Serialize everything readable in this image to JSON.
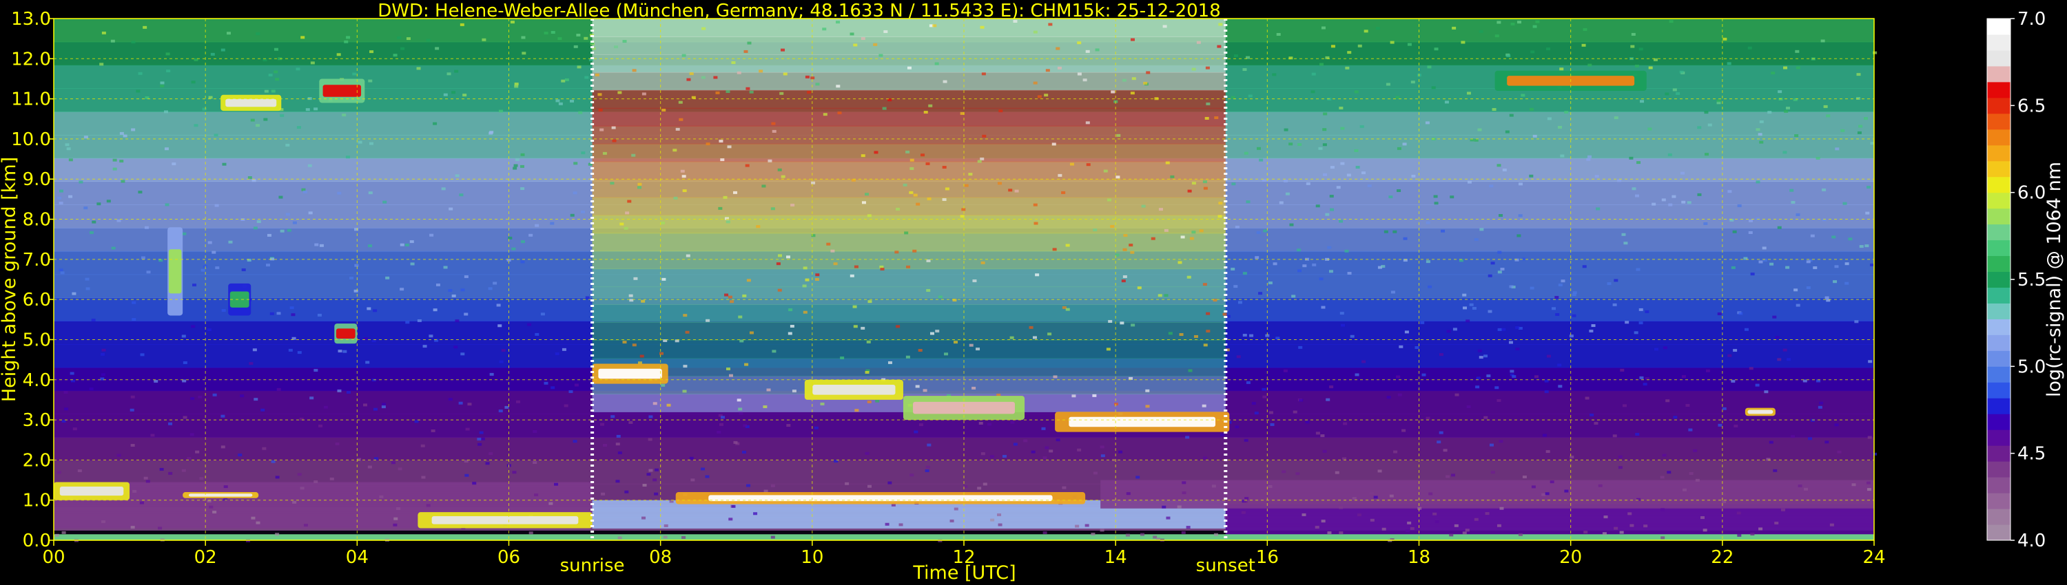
{
  "colors": {
    "text": "#ffff00",
    "grid": "#e6e600",
    "marker": "#ffffff",
    "background": "#000000",
    "colorbar_text": "#ffffff"
  },
  "chart_data": {
    "type": "heatmap",
    "title": "DWD: Helene-Weber-Allee (München, Germany; 48.1633 N / 11.5433 E):    CHM15k: 25-12-2018",
    "xlabel": "Time [UTC]",
    "ylabel": "Height above ground [km]",
    "xlim": [
      0,
      24
    ],
    "ylim": [
      0,
      13
    ],
    "x_ticks": [
      0,
      2,
      4,
      6,
      8,
      10,
      12,
      14,
      16,
      18,
      20,
      22,
      24
    ],
    "x_tick_labels": [
      "00",
      "02",
      "04",
      "06",
      "08",
      "10",
      "12",
      "14",
      "16",
      "18",
      "20",
      "22",
      "24"
    ],
    "y_ticks": [
      0,
      1,
      2,
      3,
      4,
      5,
      6,
      7,
      8,
      9,
      10,
      11,
      12,
      13
    ],
    "y_tick_labels": [
      "0.0",
      "1.0",
      "2.0",
      "3.0",
      "4.0",
      "5.0",
      "6.0",
      "7.0",
      "8.0",
      "9.0",
      "10.0",
      "11.0",
      "12.0",
      "13.0"
    ],
    "grid": true,
    "markers": [
      {
        "label": "sunrise",
        "x": 7.1
      },
      {
        "label": "sunset",
        "x": 15.45
      }
    ],
    "colorbar": {
      "label": "log(rc-signal) @ 1064 nm",
      "range": [
        4.0,
        7.0
      ],
      "ticks": [
        4.0,
        4.5,
        5.0,
        5.5,
        6.0,
        6.5,
        7.0
      ],
      "tick_labels": [
        "4.0",
        "4.5",
        "5.0",
        "5.5",
        "6.0",
        "6.5",
        "7.0"
      ],
      "colors": [
        "#a48ba6",
        "#9e7ba0",
        "#96649a",
        "#8a4f93",
        "#7d3a8c",
        "#6d1e90",
        "#5a0aa0",
        "#3b00b8",
        "#1e20d8",
        "#2e55e8",
        "#4a78e6",
        "#6b8ee8",
        "#8aa4ec",
        "#9bb8f0",
        "#70c8c0",
        "#34b88e",
        "#1aa05a",
        "#2fb45a",
        "#46c878",
        "#6ed08c",
        "#9ee05c",
        "#c8ec3c",
        "#ecec1a",
        "#f4c81a",
        "#f4a818",
        "#f08414",
        "#ec5810",
        "#e42a0c",
        "#e40808",
        "#e6b4b4",
        "#e6e6e6",
        "#eeeeee",
        "#ffffff"
      ]
    },
    "layers": [
      {
        "name": "clear-air",
        "t0": 0,
        "t1": 24,
        "h0": 0.25,
        "h1": 13,
        "signal_bottom": 4.3,
        "signal_top": 5.6
      },
      {
        "name": "daylight-noise",
        "t0": 7.1,
        "t1": 15.45,
        "h0": 3.2,
        "h1": 13,
        "signal_bottom": 5.2,
        "signal_top": 7.0
      },
      {
        "name": "boundary-layer-night",
        "t0": 0,
        "t1": 7.1,
        "h0": 0.3,
        "h1": 1.45,
        "signal": 4.4
      },
      {
        "name": "boundary-layer-day",
        "t0": 7.1,
        "t1": 15.45,
        "h0": 0.3,
        "h1": 1.0,
        "signal": 5.2
      },
      {
        "name": "boundary-layer-evening",
        "t0": 15.45,
        "t1": 24,
        "h0": 0.1,
        "h1": 0.9,
        "signal": 4.6
      },
      {
        "name": "residual-layer-evening",
        "t0": 13.8,
        "t1": 24,
        "h0": 0.8,
        "h1": 1.5,
        "signal": 4.4
      },
      {
        "name": "surface-layer",
        "t0": 0,
        "t1": 24,
        "h0": 0,
        "h1": 0.15,
        "signal": 5.8
      }
    ],
    "clouds": [
      {
        "t0": 2.2,
        "t1": 3.0,
        "h0": 10.7,
        "h1": 11.1,
        "signal": 6.8
      },
      {
        "t0": 3.5,
        "t1": 4.1,
        "h0": 10.9,
        "h1": 11.5,
        "signal": 6.6
      },
      {
        "t0": 3.7,
        "t1": 4.0,
        "h0": 4.9,
        "h1": 5.4,
        "signal": 6.6
      },
      {
        "t0": 1.5,
        "t1": 1.7,
        "h0": 5.6,
        "h1": 7.8,
        "signal": 5.9
      },
      {
        "t0": 2.3,
        "t1": 2.6,
        "h0": 5.6,
        "h1": 6.4,
        "signal": 5.6
      },
      {
        "t0": 7.1,
        "t1": 8.1,
        "h0": 3.9,
        "h1": 4.4,
        "signal": 7.0
      },
      {
        "t0": 9.9,
        "t1": 11.2,
        "h0": 3.5,
        "h1": 4.0,
        "signal": 6.8
      },
      {
        "t0": 11.2,
        "t1": 12.8,
        "h0": 3.0,
        "h1": 3.6,
        "signal": 6.7
      },
      {
        "t0": 13.2,
        "t1": 15.5,
        "h0": 2.7,
        "h1": 3.2,
        "signal": 7.0
      },
      {
        "t0": 22.3,
        "t1": 22.7,
        "h0": 3.1,
        "h1": 3.3,
        "signal": 6.9
      },
      {
        "t0": 0.0,
        "t1": 1.0,
        "h0": 1.0,
        "h1": 1.45,
        "signal": 6.8
      },
      {
        "t0": 1.7,
        "t1": 2.7,
        "h0": 1.05,
        "h1": 1.2,
        "signal": 6.9
      },
      {
        "t0": 4.8,
        "t1": 7.1,
        "h0": 0.3,
        "h1": 0.7,
        "signal": 6.8
      },
      {
        "t0": 8.2,
        "t1": 13.6,
        "h0": 0.9,
        "h1": 1.2,
        "signal": 7.0
      },
      {
        "t0": 19.0,
        "t1": 21.0,
        "h0": 11.2,
        "h1": 11.7,
        "signal": 6.3
      }
    ]
  }
}
